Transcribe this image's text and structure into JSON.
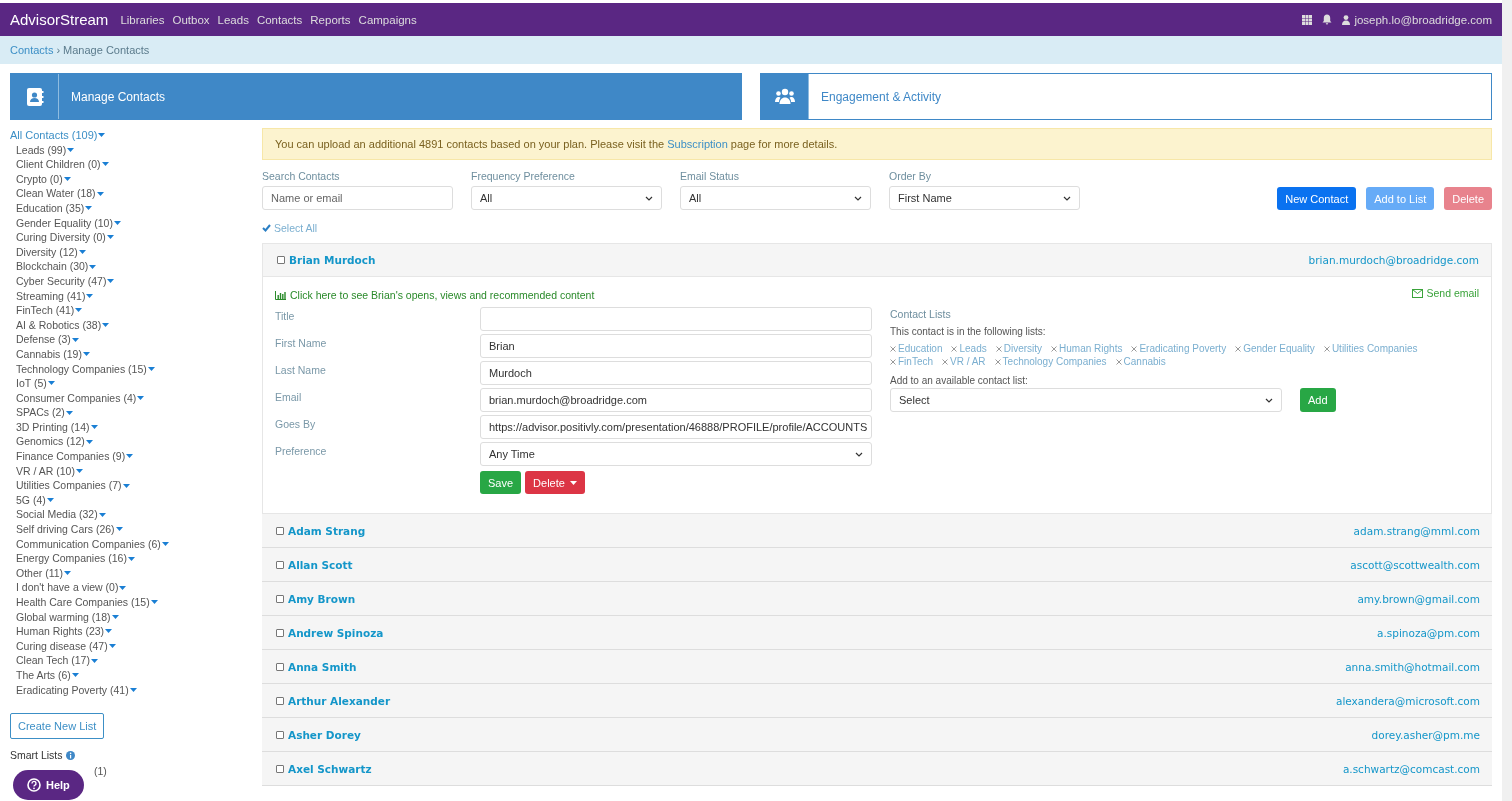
{
  "navbar": {
    "brand": "AdvisorStream",
    "links": [
      "Libraries",
      "Outbox",
      "Leads",
      "Contacts",
      "Reports",
      "Campaigns"
    ],
    "user": "joseph.lo@broadridge.com"
  },
  "breadcrumb": {
    "parent": "Contacts",
    "separator": "›",
    "current": "Manage Contacts"
  },
  "cards": [
    {
      "title": "Manage Contacts",
      "selected": true,
      "kind": "contacts"
    },
    {
      "title": "Engagement & Activity",
      "selected": false,
      "kind": "people"
    }
  ],
  "sidebar": {
    "all": "All Contacts (109)",
    "lists": [
      "Leads (99)",
      "Client Children (0)",
      "Crypto (0)",
      "Clean Water (18)",
      "Education (35)",
      "Gender Equality (10)",
      "Curing Diversity (0)",
      "Diversity (12)",
      "Blockchain (30)",
      "Cyber Security (47)",
      "Streaming (41)",
      "FinTech (41)",
      "AI & Robotics (38)",
      "Defense (3)",
      "Cannabis (19)",
      "Technology Companies (15)",
      "IoT (5)",
      "Consumer Companies (4)",
      "SPACs (2)",
      "3D Printing (14)",
      "Genomics (12)",
      "Finance Companies (9)",
      "VR / AR (10)",
      "Utilities Companies (7)",
      "5G (4)",
      "Social Media (32)",
      "Self driving Cars (26)",
      "Communication Companies (6)",
      "Energy Companies (16)",
      "Other (11)",
      "I don't have a view (0)",
      "Health Care Companies (15)",
      "Global warming (18)",
      "Human Rights (23)",
      "Curing disease (47)",
      "Clean Tech (17)",
      "The Arts (6)",
      "Eradicating Poverty (41)"
    ],
    "create_button": "Create New List",
    "smart_lists_title": "Smart Lists",
    "smart_lists": [
      "(1)"
    ]
  },
  "help_button": "Help",
  "alert": "You can upload an additional 4891 contacts based on your plan. Please visit the **Subscription** page for more details.",
  "filters": [
    {
      "label": "Search Contacts",
      "kind": "input",
      "placeholder": "Name or email"
    },
    {
      "label": "Frequency Preference",
      "kind": "select",
      "value": "All"
    },
    {
      "label": "Email Status",
      "kind": "select",
      "value": "All"
    },
    {
      "label": "Order By",
      "kind": "select",
      "value": "First Name"
    }
  ],
  "actions": [
    {
      "label": "New Contact",
      "kind": "primary",
      "disabled": false
    },
    {
      "label": "Add to List",
      "kind": "primary",
      "disabled": true
    },
    {
      "label": "Delete",
      "kind": "danger",
      "disabled": true
    }
  ],
  "select_all": "Select All",
  "contacts": [
    {
      "name": "Brian Murdoch",
      "email": "brian.murdoch@broadridge.com",
      "checked": false,
      "expanded": true,
      "details": {
        "activity_link": "Click here to see Brian's opens, views and recommended content",
        "send_email": "Send email",
        "fields": [
          {
            "label": "Title",
            "kind": "input"
          },
          {
            "label": "First Name",
            "kind": "input",
            "value": "Brian"
          },
          {
            "label": "Last Name",
            "kind": "input",
            "value": "Murdoch"
          },
          {
            "label": "Email",
            "kind": "input",
            "value": "brian.murdoch@broadridge.com"
          },
          {
            "label": "Goes By",
            "kind": "input",
            "value": "https://advisor.positivly.com/presentation/46888/PROFILE/profile/ACCOUNTS"
          },
          {
            "label": "Preference",
            "kind": "select",
            "value": "Any Time"
          }
        ],
        "save": "Save",
        "delete": "Delete",
        "lists_title": "Contact Lists",
        "lists_note": "This contact is in the following lists:",
        "lists": [
          "Education",
          "Leads",
          "Diversity",
          "Human Rights",
          "Eradicating Poverty",
          "Gender Equality",
          "Utilities Companies",
          "FinTech",
          "VR / AR",
          "Technology Companies",
          "Cannabis"
        ],
        "add_label": "Add to an available contact list:",
        "add_select": "Select",
        "add_button": "Add"
      }
    },
    {
      "name": "Adam Strang",
      "email": "adam.strang@mml.com",
      "checked": false,
      "expanded": false
    },
    {
      "name": "Allan Scott",
      "email": "ascott@scottwealth.com",
      "checked": false,
      "expanded": false
    },
    {
      "name": "Amy Brown",
      "email": "amy.brown@gmail.com",
      "checked": false,
      "expanded": false
    },
    {
      "name": "Andrew Spinoza",
      "email": "a.spinoza@pm.com",
      "checked": false,
      "expanded": false
    },
    {
      "name": "Anna Smith",
      "email": "anna.smith@hotmail.com",
      "checked": false,
      "expanded": false
    },
    {
      "name": "Arthur Alexander",
      "email": "alexandera@microsoft.com",
      "checked": false,
      "expanded": false
    },
    {
      "name": "Asher Dorey",
      "email": "dorey.asher@pm.me",
      "checked": false,
      "expanded": false
    },
    {
      "name": "Axel Schwartz",
      "email": "a.schwartz@comcast.com",
      "checked": false,
      "expanded": false
    }
  ]
}
